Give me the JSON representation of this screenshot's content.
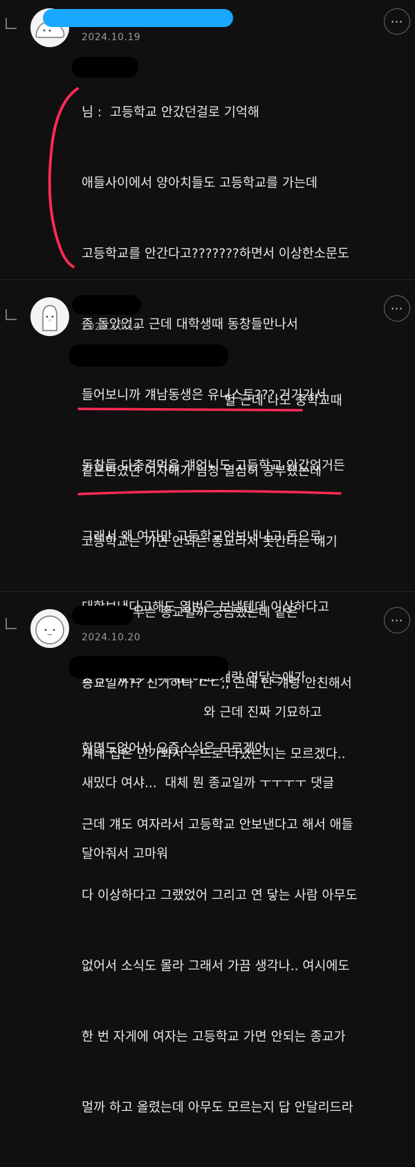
{
  "comments": [
    {
      "date": "2024.10.19",
      "lines": [
        "님 :  고등학교 안갔던걸로 기억해",
        "애들사이에서 양아치들도 고등학교를 가는데",
        "고등학교를 안간다고???????하면서 이상한소문도",
        "좀 돌았었고 근데 대학생때 동창들만나서",
        "들어보니까 걔남동생은 유니스트??? 거기가서",
        "동창들 다충격먹음 걔언니도 고등학교 안갔었거든",
        "그래서 왜 여자만 고등학교안보내냐고 돈으로",
        "대학보낸다고해도 열번은 보낼텐데 이상하다고",
        "웅성거렸던거 이게끝이고 걔랑 연닿는애가",
        "한명도없어서 요즘소식은 모르겠어"
      ]
    },
    {
      "date": "2024.10.19",
      "lines": [
        "                                   헐 근데 나도 중학교때",
        "같은반였던 여자애가 엄청 열심히 공부했는데",
        "고등학교는 가면 안되는 종교라서 못간다는 얘기",
        "들었어서 무슨 종교일까 궁금했는데 같은",
        "종교일까?? 신기하다 ㄷㄷ;; 근데 난 걔랑 안친해서",
        "걔네 집은 안가봐서 누드로 다녔는지는 모르겠다..",
        "근데 걔도 여자라서 고등학교 안보낸다고 해서 애들",
        "다 이상하다고 그랬었어 그리고 연 닿는 사람 아무도",
        "없어서 소식도 몰라 그래서 가끔 생각나.. 여시에도",
        "한 번 자게에 여자는 고등학교 가면 안되는 종교가",
        "멀까 하고 올렸는데 아무도 모르는지 답 안달리드라"
      ]
    },
    {
      "date": "2024.10.20",
      "lines": [
        "                              와 근데 진짜 기묘하고",
        "새밌다 여샤...  대체 뭔 종교일까 ㅜㅜㅜㅜ 댓글",
        "달아줘서 고마워"
      ]
    }
  ],
  "more_icon": "⋯",
  "colors": {
    "background": "#101010",
    "text": "#e9e9e9",
    "date": "#9a9a9a",
    "annotation": "#ff2a55",
    "name_highlight": "#1aa7ff"
  }
}
